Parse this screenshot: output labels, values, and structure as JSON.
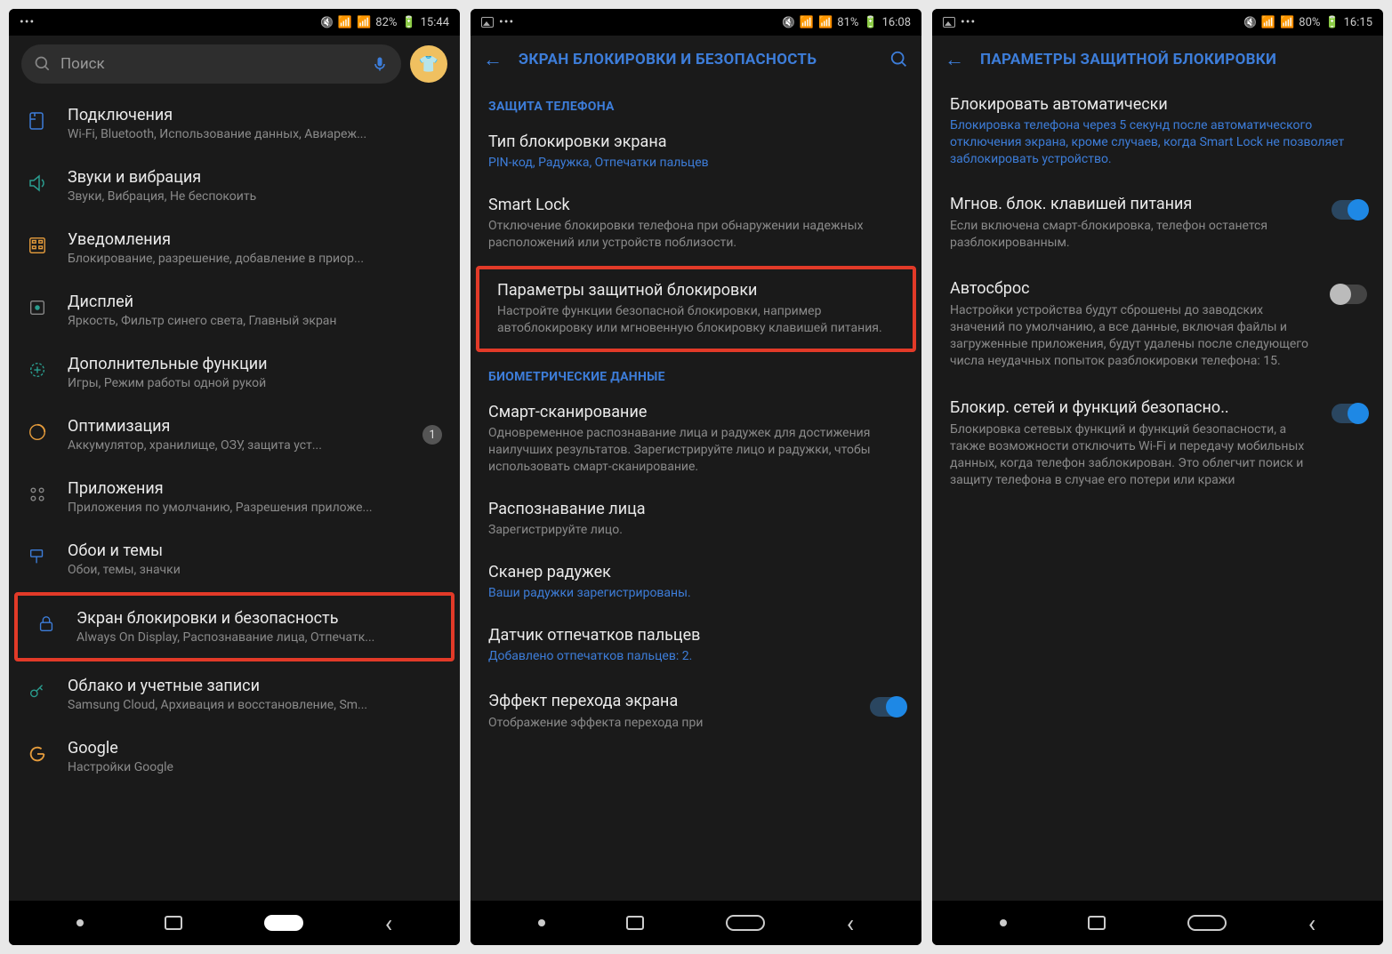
{
  "screen1": {
    "status": {
      "battery": "82%",
      "time": "15:44"
    },
    "search_placeholder": "Поиск",
    "items": [
      {
        "title": "Подключения",
        "sub": "Wi-Fi, Bluetooth, Использование данных, Авиареж..."
      },
      {
        "title": "Звуки и вибрация",
        "sub": "Звуки, Вибрация, Не беспокоить"
      },
      {
        "title": "Уведомления",
        "sub": "Блокирование, разрешение, добавление в приор..."
      },
      {
        "title": "Дисплей",
        "sub": "Яркость, Фильтр синего света, Главный экран"
      },
      {
        "title": "Дополнительные функции",
        "sub": "Игры, Режим работы одной рукой"
      },
      {
        "title": "Оптимизация",
        "sub": "Аккумулятор, хранилище, ОЗУ, защита уст...",
        "badge": "1"
      },
      {
        "title": "Приложения",
        "sub": "Приложения по умолчанию, Разрешения приложе..."
      },
      {
        "title": "Обои и темы",
        "sub": "Обои, темы, значки"
      },
      {
        "title": "Экран блокировки и безопасность",
        "sub": "Always On Display, Распознавание лица, Отпечатк..."
      },
      {
        "title": "Облако и учетные записи",
        "sub": "Samsung Cloud, Архивация и восстановление, Sm..."
      },
      {
        "title": "Google",
        "sub": "Настройки Google"
      }
    ]
  },
  "screen2": {
    "status": {
      "battery": "81%",
      "time": "16:08"
    },
    "header": "ЭКРАН БЛОКИРОВКИ И БЕЗОПАСНОСТЬ",
    "section1": "ЗАЩИТА ТЕЛЕФОНА",
    "section2": "БИОМЕТРИЧЕСКИЕ ДАННЫЕ",
    "items": [
      {
        "title": "Тип блокировки экрана",
        "sub": "PIN-код, Радужка, Отпечатки пальцев",
        "link": true
      },
      {
        "title": "Smart Lock",
        "sub": "Отключение блокировки телефона при обнаружении надежных расположений или устройств поблизости."
      },
      {
        "title": "Параметры защитной блокировки",
        "sub": "Настройте функции безопасной блокировки, например автоблокировку или мгновенную блокировку клавишей питания."
      },
      {
        "title": "Смарт-сканирование",
        "sub": "Одновременное распознавание лица и радужек для достижения наилучших результатов. Зарегистрируйте лицо и радужки, чтобы использовать смарт-сканирование."
      },
      {
        "title": "Распознавание лица",
        "sub": "Зарегистрируйте лицо."
      },
      {
        "title": "Сканер радужек",
        "sub": "Ваши радужки зарегистрированы.",
        "link": true
      },
      {
        "title": "Датчик отпечатков пальцев",
        "sub": "Добавлено отпечатков пальцев: 2.",
        "link": true
      },
      {
        "title": "Эффект перехода экрана",
        "sub": "Отображение эффекта перехода при"
      }
    ]
  },
  "screen3": {
    "status": {
      "battery": "80%",
      "time": "16:15"
    },
    "header": "ПАРАМЕТРЫ ЗАЩИТНОЙ БЛОКИРОВКИ",
    "items": [
      {
        "title": "Блокировать автоматически",
        "sub": "Блокировка телефона через 5 секунд после автоматического отключения экрана, кроме случаев, когда Smart Lock не позволяет заблокировать устройство.",
        "link": true
      },
      {
        "title": "Мгнов. блок. клавишей питания",
        "sub": "Если включена смарт-блокировка, телефон останется разблокированным.",
        "toggle": "on"
      },
      {
        "title": "Автосброс",
        "sub": "Настройки устройства будут сброшены до заводских значений по умолчанию, а все данные, включая файлы и загруженные приложения, будут удалены после следующего числа неудачных попыток разблокировки телефона: 15.",
        "toggle": "off"
      },
      {
        "title": "Блокир. сетей и функций безопасно..",
        "sub": "Блокировка сетевых функций и функций безопасности, а также возможности отключить Wi-Fi и передачу мобильных данных, когда телефон заблокирован. Это облегчит поиск и защиту телефона в случае его потери или кражи",
        "toggle": "on"
      }
    ]
  }
}
